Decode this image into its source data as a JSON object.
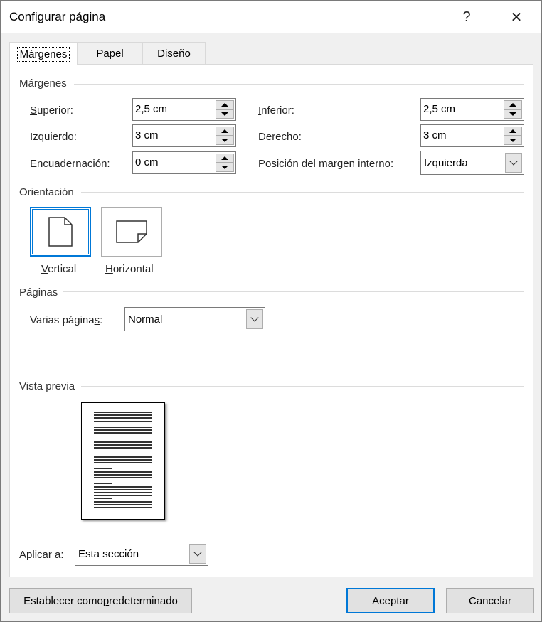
{
  "window": {
    "title": "Configurar página",
    "help_glyph": "?",
    "close_glyph": "✕"
  },
  "tabs": [
    {
      "label": "Márgenes",
      "active": true
    },
    {
      "label": "Papel",
      "active": false
    },
    {
      "label": "Diseño",
      "active": false
    }
  ],
  "margins": {
    "group_label": "Márgenes",
    "top": {
      "label_u": "S",
      "label_rest": "uperior:",
      "value": "2,5 cm"
    },
    "bottom": {
      "label_u": "I",
      "label_rest": "nferior:",
      "value": "2,5 cm"
    },
    "left": {
      "label_u": "I",
      "label_rest": "zquierdo:",
      "value": "3 cm"
    },
    "right": {
      "label_pre": "D",
      "label_u": "e",
      "label_rest": "recho:",
      "value": "3 cm"
    },
    "gutter": {
      "label_pre": "E",
      "label_u": "n",
      "label_rest": "cuadernación:",
      "value": "0 cm"
    },
    "gutter_pos": {
      "label_pre": "Posición del ",
      "label_u": "m",
      "label_rest": "argen interno:",
      "value": "Izquierda"
    }
  },
  "orientation": {
    "group_label": "Orientación",
    "portrait": {
      "label_u": "V",
      "label_rest": "ertical",
      "selected": true
    },
    "landscape": {
      "label_u": "H",
      "label_rest": "orizontal",
      "selected": false
    }
  },
  "pages": {
    "group_label": "Páginas",
    "multiple_label_pre": "Varias página",
    "multiple_label_u": "s",
    "multiple_label_post": ":",
    "multiple_value": "Normal"
  },
  "preview": {
    "group_label": "Vista previa"
  },
  "apply_to": {
    "label_pre": "Apl",
    "label_u": "i",
    "label_rest": "car a:",
    "value": "Esta sección"
  },
  "buttons": {
    "set_default_pre": "Establecer como ",
    "set_default_u": "p",
    "set_default_rest": "redeterminado",
    "ok": "Aceptar",
    "cancel": "Cancelar"
  },
  "colors": {
    "accent": "#0078d7",
    "dialog_bg": "#f0f0f0",
    "panel_bg": "#ffffff"
  }
}
